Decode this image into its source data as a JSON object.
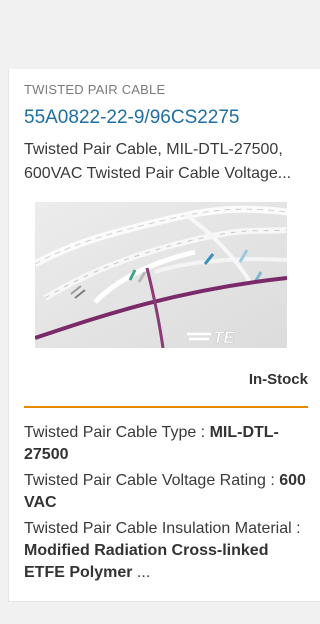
{
  "product_card": {
    "category": "TWISTED PAIR CABLE",
    "part_number": "55A0822-22-9/96CS2275",
    "description": "Twisted Pair Cable, MIL-DTL-27500, 600VAC Twisted Pair Cable Voltage...",
    "image_logo_text": "TE",
    "stock_status": "In-Stock",
    "attributes": [
      {
        "label": "Twisted Pair Cable Type : ",
        "value": "MIL-DTL-27500",
        "suffix": ""
      },
      {
        "label": "Twisted Pair Cable Voltage Rating : ",
        "value": "600 VAC",
        "suffix": ""
      },
      {
        "label": "Twisted Pair Cable Insulation Material : ",
        "value": "Modified Radiation Cross-linked ETFE Polymer",
        "suffix": " ..."
      }
    ]
  },
  "colors": {
    "link": "#1d6fa5",
    "accent_divider": "#e68a00",
    "page_background": "#f1f1f1",
    "card_background": "#ffffff"
  }
}
